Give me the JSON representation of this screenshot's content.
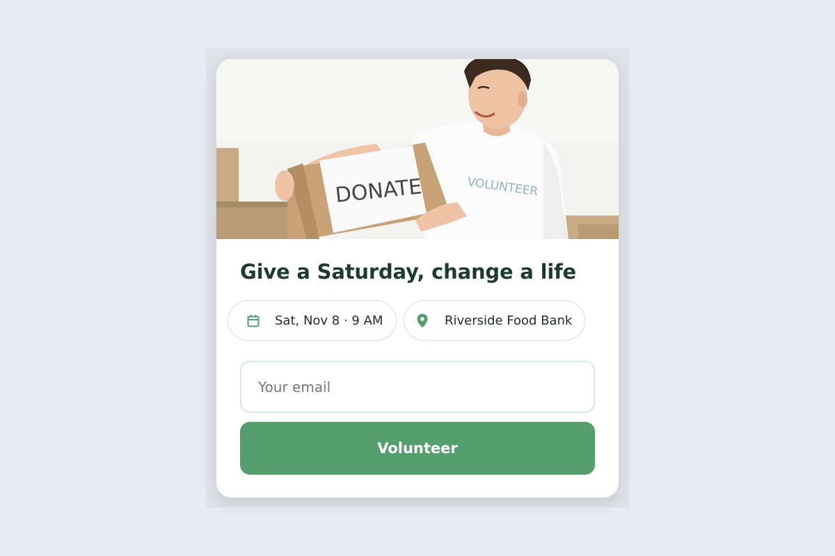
{
  "card": {
    "title": "Give a Saturday, change a life",
    "image": {
      "box_label": "DONATE",
      "shirt_label": "VOLUNTEER"
    }
  },
  "details": {
    "date": {
      "icon": "calendar-icon",
      "label": "Sat, Nov 8 · 9 AM"
    },
    "location": {
      "icon": "map-pin-icon",
      "label": "Riverside Food Bank"
    }
  },
  "form": {
    "email_placeholder": "Your email",
    "email_value": "",
    "submit_label": "Volunteer"
  },
  "colors": {
    "accent": "#559e6e",
    "title": "#1d3b2e",
    "chip_border": "#cfe3d6",
    "page_background": "#e8ebf0"
  }
}
